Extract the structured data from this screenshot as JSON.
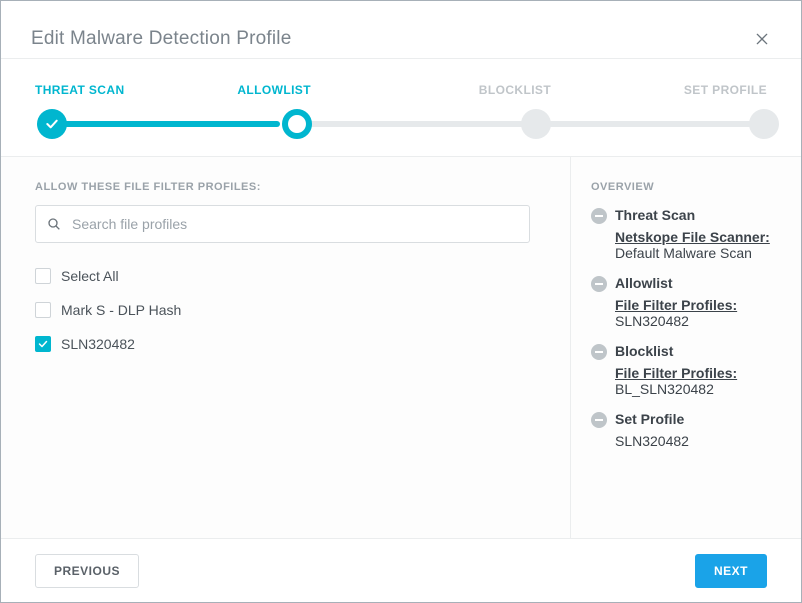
{
  "dialog": {
    "title": "Edit Malware Detection Profile"
  },
  "stepper": {
    "steps": [
      {
        "label": "THREAT SCAN",
        "state": "done"
      },
      {
        "label": "ALLOWLIST",
        "state": "current"
      },
      {
        "label": "BLOCKLIST",
        "state": "future"
      },
      {
        "label": "SET PROFILE",
        "state": "future"
      }
    ]
  },
  "left": {
    "heading": "ALLOW THESE FILE FILTER PROFILES:",
    "search_placeholder": "Search file profiles",
    "items": [
      {
        "label": "Select All",
        "checked": false
      },
      {
        "label": "Mark S - DLP Hash",
        "checked": false
      },
      {
        "label": "SLN320482",
        "checked": true
      }
    ]
  },
  "overview": {
    "heading": "OVERVIEW",
    "sections": [
      {
        "title": "Threat Scan",
        "link": "Netskope File Scanner:",
        "value": "Default Malware Scan"
      },
      {
        "title": "Allowlist",
        "link": "File Filter Profiles:",
        "value": "SLN320482"
      },
      {
        "title": "Blocklist",
        "link": "File Filter Profiles:",
        "value": "BL_SLN320482"
      },
      {
        "title": "Set Profile",
        "link": "",
        "value": "SLN320482"
      }
    ]
  },
  "footer": {
    "previous": "PREVIOUS",
    "next": "NEXT"
  }
}
